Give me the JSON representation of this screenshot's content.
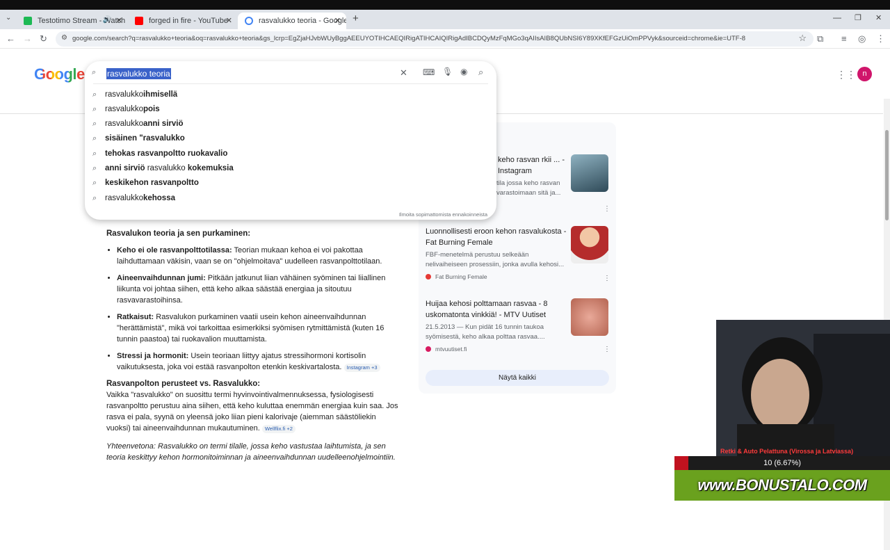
{
  "browser": {
    "tabs": [
      {
        "label": "Testotimo Stream - Watch L",
        "favicon_color": "#1db954"
      },
      {
        "label": "forged in fire - YouTube",
        "favicon_color": "#ff0000"
      },
      {
        "label": "rasvalukko teoria - Google-hak",
        "favicon_color": "#4285f4"
      }
    ],
    "new_tab": "+",
    "url": "google.com/search?q=rasvalukko+teoria&oq=rasvalukko+teoria&gs_lcrp=EgZjaHJvbWUyBggAEEUYOTIHCAEQIRigATIHCAIQIRigAdIBCDQyMzFqMGo3qAIIsAIB8QUbNSI6Y89XKfEFGzUiOmPPVyk&sourceid=chrome&ie=UTF-8"
  },
  "google": {
    "logo": "Google",
    "query": "rasvalukko teoria",
    "suggestions": [
      {
        "pre": "rasvalukko ",
        "bold": "ihmisellä",
        "post": ""
      },
      {
        "pre": "rasvalukko ",
        "bold": "pois",
        "post": ""
      },
      {
        "pre": "rasvalukko ",
        "bold": "anni sirviö",
        "post": ""
      },
      {
        "pre": "",
        "bold": "sisäinen \"rasvalukko",
        "post": ""
      },
      {
        "pre": "",
        "bold": "tehokas rasvanpoltto ruokavalio",
        "post": ""
      },
      {
        "pre": "",
        "bold": "anni sirviö",
        "post": " rasvalukko ",
        "bold2": "kokemuksia"
      },
      {
        "pre": "",
        "bold": "keskikehon rasvanpoltto",
        "post": ""
      },
      {
        "pre": "rasvalukko ",
        "bold": "kehossa",
        "post": ""
      }
    ],
    "report_link": "Ilmoita sopimattomista ennakoinneista",
    "avatar_letter": "n"
  },
  "answer": {
    "heading": "Rasvalukon teoria ja sen purkaminen:",
    "bullets": [
      {
        "strong": "Keho ei ole rasvanpolttotilassa:",
        "text": " Teorian mukaan kehoa ei voi pakottaa laihduttamaan väkisin, vaan se on \"ohjelmoitava\" uudelleen rasvanpolttotilaan."
      },
      {
        "strong": "Aineenvaihdunnan jumi:",
        "text": " Pitkään jatkunut liian vähäinen syöminen tai liiallinen liikunta voi johtaa siihen, että keho alkaa säästää energiaa ja sitoutuu rasvavarastoihinsa."
      },
      {
        "strong": "Ratkaisut:",
        "text": " Rasvalukon purkaminen vaatii usein kehon aineenvaihdunnan \"herättämistä\", mikä voi tarkoittaa esimerkiksi syömisen rytmittämistä (kuten 16 tunnin paastoa) tai ruokavalion muuttamista."
      },
      {
        "strong": "Stressi ja hormonit:",
        "text": " Usein teoriaan liittyy ajatus stressihormoni kortisolin vaikutuksesta, joka voi estää rasvanpolton etenkin keskivartalosta.",
        "chip": "Instagram +3"
      }
    ],
    "heading2": "Rasvanpolton perusteet vs. Rasvalukko:",
    "paragraph": "Vaikka \"rasvalukko\" on suosittu termi hyvinvointivalmennuksessa, fysiologisesti rasvanpoltto perustuu aina siihen, että keho kuluttaa enemmän energiaa kuin saa. Jos rasva ei pala, syynä on yleensä joko liian pieni kalorivaje (aiemman säästöliekin vuoksi) tai aineenvaihdunnan mukautuminen.",
    "paragraph_chip": "Wellflix.fi +2",
    "summary": "Yhteenvetona: Rasvalukko on termi tilalle, jossa keho vastustaa laihtumista, ja sen teoria keskittyy kehon hormonitoiminnan ja aineenvaihdunnan uudelleenohjelmointiin."
  },
  "sources": {
    "cards": [
      {
        "title": "keho rasvan rkii ... - Instagram",
        "desc": "tila jossa keho rasvan varastoimaan sitä ja...",
        "src": "",
        "thumb_color": "#4a6b78"
      },
      {
        "title": "Luonnollisesti eroon kehon rasvalukosta - Fat Burning Female",
        "desc": "FBF-menetelmä perustuu selkeään nelivaiheiseen prosessiin, jonka avulla kehosi...",
        "src": "Fat Burning Female",
        "src_color": "#e53935",
        "thumb_color": "#c0392b"
      },
      {
        "title": "Huijaa kehosi polttamaan rasvaa - 8 uskomatonta vinkkiä! - MTV Uutiset",
        "desc": "21.5.2013 — Kun pidät 16 tunnin taukoa syömisestä, keho alkaa polttaa rasvaa....",
        "src": "mtvuutiset.fi",
        "src_color": "#d81b60",
        "thumb_color": "#d98b7a"
      }
    ],
    "show_all": "Näytä kaikki"
  },
  "stream_overlay": {
    "title": "Retki & Auto Pelattuna (Virossa ja Latviassa)",
    "counter": "10 (6.67%)",
    "banner": "www.BONUSTALO.COM"
  }
}
